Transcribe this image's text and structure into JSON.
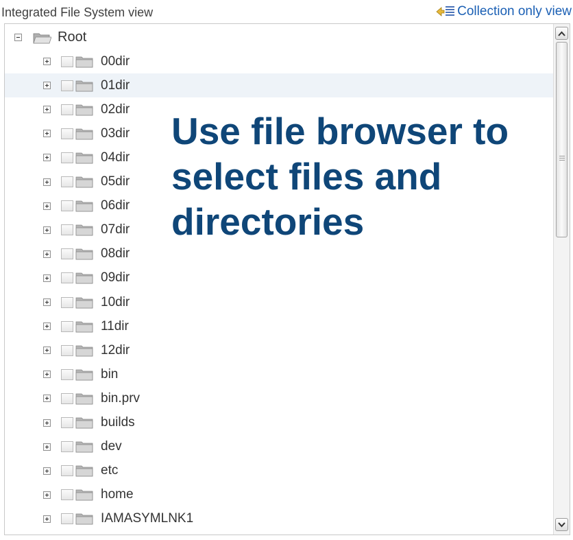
{
  "header": {
    "title": "Integrated File System view",
    "collection_link": "Collection only view"
  },
  "tree": {
    "root_label": "Root",
    "items": [
      {
        "label": "00dir"
      },
      {
        "label": "01dir"
      },
      {
        "label": "02dir"
      },
      {
        "label": "03dir"
      },
      {
        "label": "04dir"
      },
      {
        "label": "05dir"
      },
      {
        "label": "06dir"
      },
      {
        "label": "07dir"
      },
      {
        "label": "08dir"
      },
      {
        "label": "09dir"
      },
      {
        "label": "10dir"
      },
      {
        "label": "11dir"
      },
      {
        "label": "12dir"
      },
      {
        "label": "bin"
      },
      {
        "label": "bin.prv"
      },
      {
        "label": "builds"
      },
      {
        "label": "dev"
      },
      {
        "label": "etc"
      },
      {
        "label": "home"
      },
      {
        "label": "IAMASYMLNK1"
      }
    ]
  },
  "overlay": {
    "lines": [
      "Use file browser to",
      "select files and",
      "directories"
    ]
  },
  "colors": {
    "overlay_text": "#0f4678",
    "link": "#1a5fb4",
    "highlight_row": "#eef3f8"
  },
  "icons": {
    "collection": "collection-list-icon",
    "folder": "folder-icon",
    "expand": "expand-plus-icon",
    "collapse": "collapse-minus-icon"
  }
}
